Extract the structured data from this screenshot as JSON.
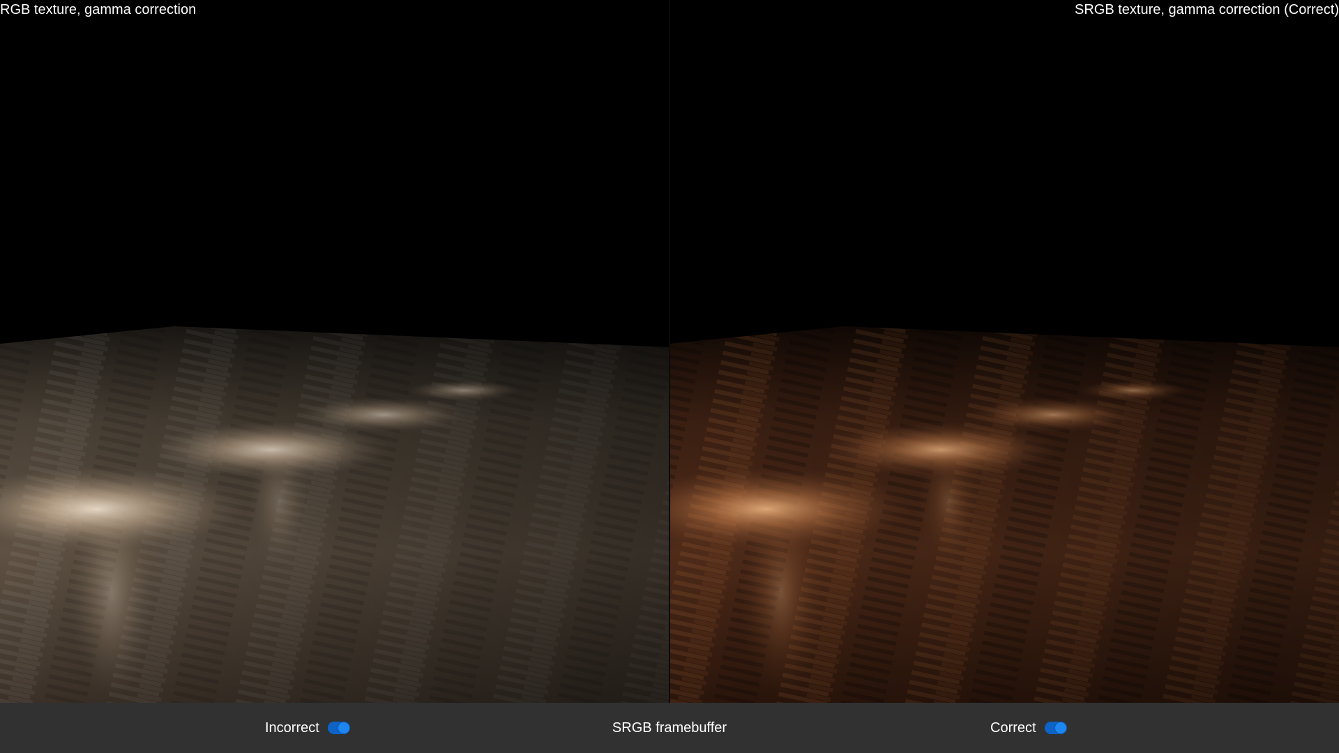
{
  "viewports": {
    "left": {
      "label": "RGB texture, gamma correction",
      "floor_color": "#8a7a66",
      "highlight_color": "#fff0dc"
    },
    "right": {
      "label": "SRGB texture, gamma correction (Correct)",
      "floor_color": "#6b3a22",
      "highlight_color": "#ffc28a"
    }
  },
  "bottom_bar": {
    "left_toggle": {
      "label": "Incorrect",
      "checked": true
    },
    "center_label": "SRGB framebuffer",
    "right_toggle": {
      "label": "Correct",
      "checked": true
    }
  },
  "colors": {
    "bar_background": "#313131",
    "toggle_accent": "#0d63c6"
  }
}
